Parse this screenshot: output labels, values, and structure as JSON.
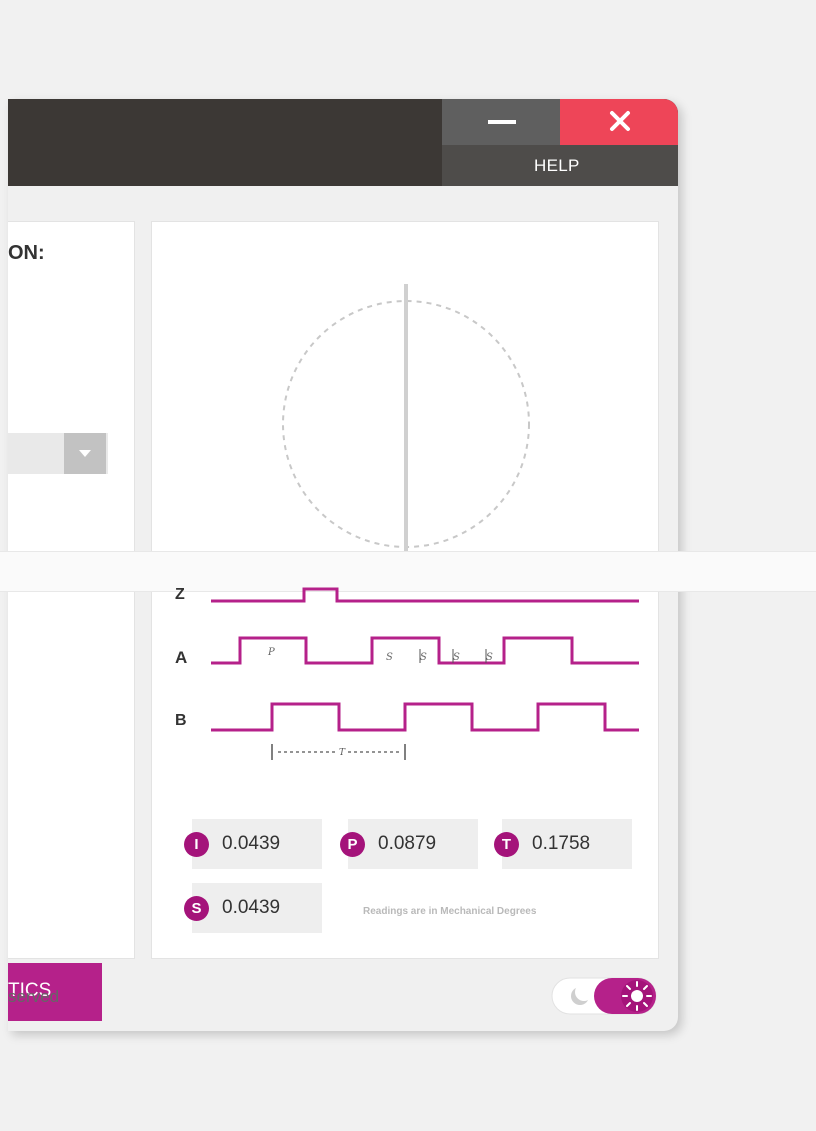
{
  "titlebar": {
    "help_label": "HELP",
    "minimize_icon": "minimize-icon",
    "close_icon": "close-icon"
  },
  "left_panel": {
    "section_title": "ON:",
    "diagnostics_label": "TICS",
    "footer_text": "served"
  },
  "waveforms": {
    "channels": [
      "Z",
      "A",
      "B"
    ],
    "pulse_labels_a": [
      "P",
      "S",
      "S",
      "S",
      "S"
    ],
    "period_label": "T"
  },
  "readings": {
    "items": [
      {
        "badge": "I",
        "value": "0.0439"
      },
      {
        "badge": "P",
        "value": "0.0879"
      },
      {
        "badge": "T",
        "value": "0.1758"
      },
      {
        "badge": "S",
        "value": "0.0439"
      }
    ],
    "note": "Readings are in Mechanical Degrees"
  },
  "theme_toggle": {
    "state": "light",
    "icons": [
      "moon-icon",
      "sun-icon"
    ]
  },
  "colors": {
    "accent": "#b5218a",
    "wave": "#b5218a",
    "close": "#ee4558",
    "titlebar": "#3c3835"
  }
}
